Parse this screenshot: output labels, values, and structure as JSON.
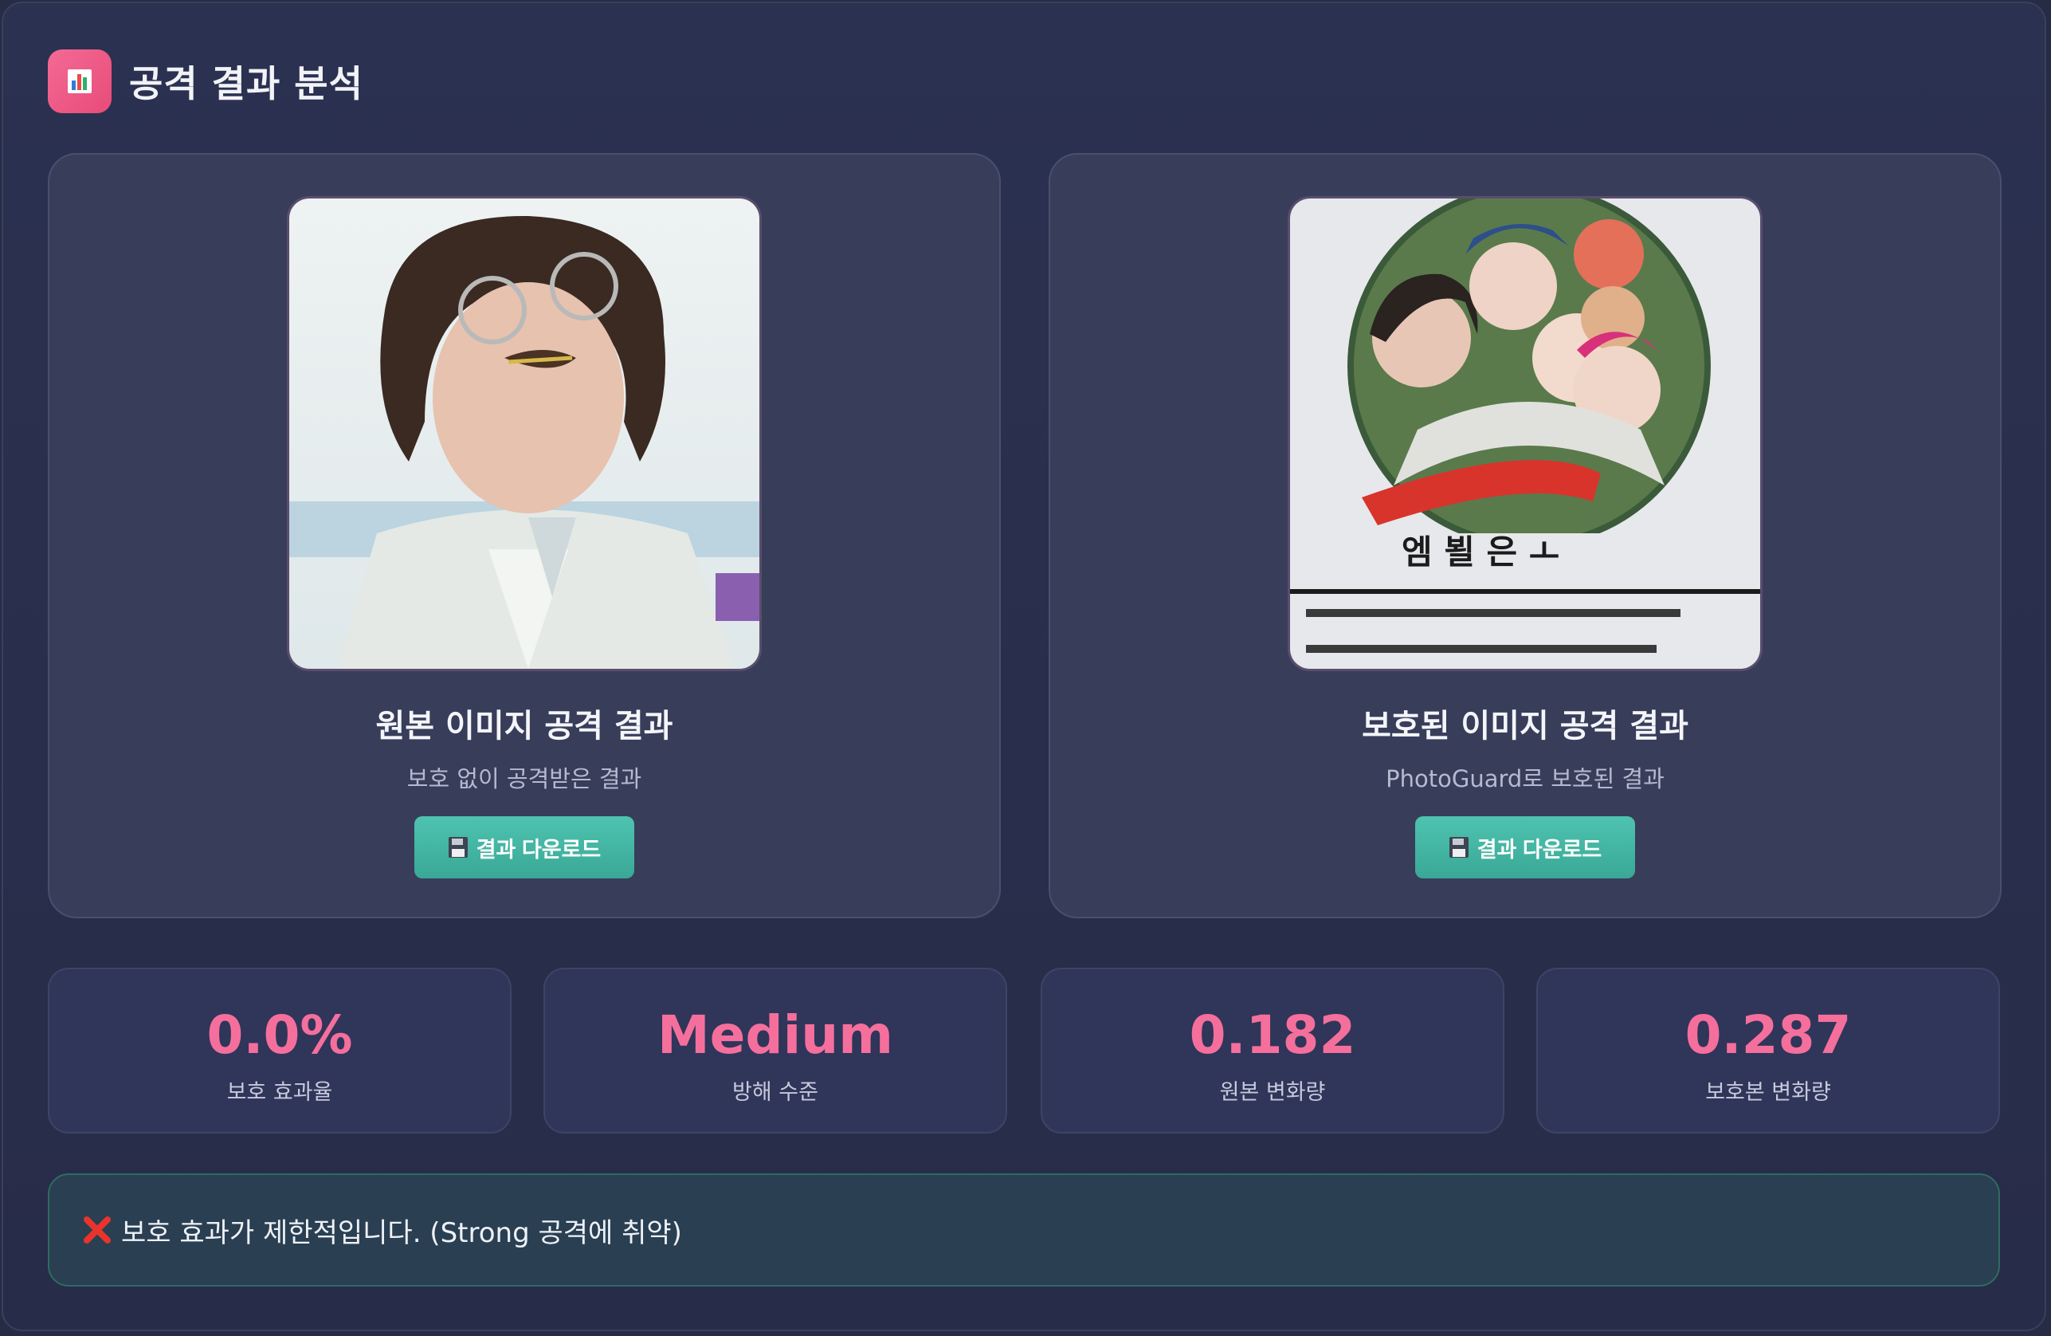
{
  "header": {
    "icon": "bar-chart-icon",
    "title": "공격 결과 분석"
  },
  "cards": [
    {
      "title": "원본 이미지 공격 결과",
      "subtitle": "보호 없이 공격받은 결과",
      "button_icon": "floppy-disk-icon",
      "button_label": "결과 다운로드"
    },
    {
      "title": "보호된 이미지 공격 결과",
      "subtitle": "PhotoGuard로 보호된 결과",
      "button_icon": "floppy-disk-icon",
      "button_label": "결과 다운로드"
    }
  ],
  "stats": [
    {
      "value": "0.0%",
      "label": "보호 효과율"
    },
    {
      "value": "Medium",
      "label": "방해 수준"
    },
    {
      "value": "0.182",
      "label": "원본 변화량"
    },
    {
      "value": "0.287",
      "label": "보호본 변화량"
    }
  ],
  "alert": {
    "icon": "cross-mark-icon",
    "text": "보호 효과가 제한적입니다. (Strong 공격에 취약)"
  },
  "colors": {
    "background": "#272c45",
    "card": "#383d5a",
    "accent_pink": "#f56f9c",
    "button_teal": "#4ec3b0",
    "alert_bg": "#2a3f52"
  }
}
